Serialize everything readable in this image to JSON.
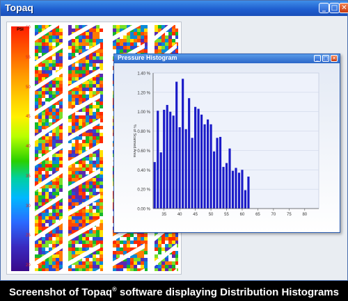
{
  "app": {
    "title": "Topaq",
    "buttons": {
      "minimize": "_",
      "maximize": "□",
      "close": "✕"
    }
  },
  "tire_panel": {
    "scale_unit": "PSI",
    "scale_ticks": [
      "60",
      "55",
      "50",
      "45",
      "40",
      "35",
      "30",
      "25",
      "20"
    ]
  },
  "histogram_window": {
    "title": "Pressure Histogram",
    "buttons": {
      "minimize": "_",
      "maximize": "□",
      "close": "✕"
    }
  },
  "chart_data": {
    "type": "bar",
    "ylabel": "% of Scanned Area",
    "xlabel": "",
    "ylim": [
      0,
      1.4
    ],
    "yticks": [
      "0.00 %",
      "0.20 %",
      "0.40 %",
      "0.60 %",
      "0.80 %",
      "1.00 %",
      "1.20 %",
      "1.40 %"
    ],
    "xticks": [
      "35",
      "40",
      "45",
      "50",
      "55",
      "60",
      "65",
      "70",
      "75",
      "80"
    ],
    "x": [
      32,
      33,
      34,
      35,
      36,
      37,
      38,
      39,
      40,
      41,
      42,
      43,
      44,
      45,
      46,
      47,
      48,
      49,
      50,
      51,
      52,
      53,
      54,
      55,
      56,
      57,
      58,
      59,
      60,
      61,
      62,
      63,
      64,
      65,
      66,
      67,
      68,
      69,
      70,
      71,
      72,
      73,
      74,
      75,
      76,
      77,
      78,
      79,
      80,
      81,
      82,
      83,
      84
    ],
    "values": [
      0.48,
      1.01,
      0.58,
      1.02,
      1.07,
      1.0,
      0.96,
      1.31,
      0.84,
      1.34,
      0.82,
      1.14,
      0.73,
      1.05,
      1.03,
      0.97,
      0.87,
      0.92,
      0.87,
      0.59,
      0.73,
      0.74,
      0.43,
      0.47,
      0.62,
      0.39,
      0.42,
      0.37,
      0.4,
      0.19,
      0.33
    ],
    "bar_color": "#1a1ac8",
    "grid": true
  },
  "caption": {
    "text_before": "Screenshot of Topaq",
    "superscript": "®",
    "text_after": " software displaying Distribution Histograms"
  }
}
